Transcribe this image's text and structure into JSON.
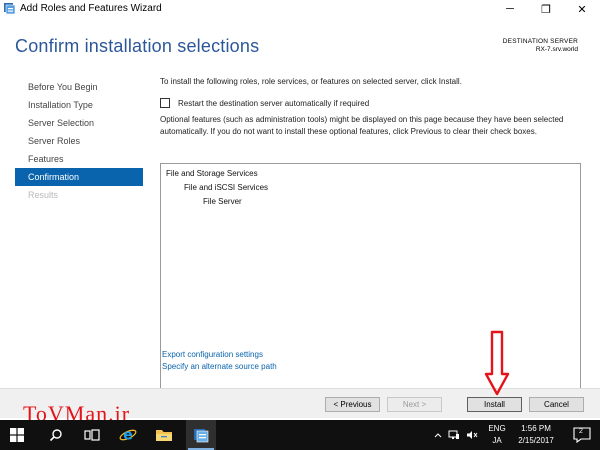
{
  "window": {
    "title": "Add Roles and Features Wizard",
    "minimize_glyph": "─",
    "maximize_glyph": "❐",
    "close_glyph": "✕"
  },
  "header": {
    "title": "Confirm installation selections",
    "destination_label": "DESTINATION SERVER",
    "destination_server": "RX-7.srv.world"
  },
  "sidebar": {
    "items": [
      {
        "label": "Before You Begin",
        "state": "normal"
      },
      {
        "label": "Installation Type",
        "state": "normal"
      },
      {
        "label": "Server Selection",
        "state": "normal"
      },
      {
        "label": "Server Roles",
        "state": "normal"
      },
      {
        "label": "Features",
        "state": "normal"
      },
      {
        "label": "Confirmation",
        "state": "active"
      },
      {
        "label": "Results",
        "state": "disabled"
      }
    ]
  },
  "main": {
    "intro": "To install the following roles, role services, or features on selected server, click Install.",
    "restart_label": "Restart the destination server automatically if required",
    "restart_checked": false,
    "optional_text": "Optional features (such as administration tools) might be displayed on this page because they have been selected automatically. If you do not want to install these optional features, click Previous to clear their check boxes.",
    "features": [
      {
        "label": "File and Storage Services",
        "level": 0
      },
      {
        "label": "File and iSCSI Services",
        "level": 1
      },
      {
        "label": "File Server",
        "level": 2
      }
    ],
    "link_export": "Export configuration settings",
    "link_source": "Specify an alternate source path"
  },
  "footer": {
    "previous_label": "< Previous",
    "next_label": "Next >",
    "install_label": "Install",
    "cancel_label": "Cancel"
  },
  "watermark": "ToVMan.ir",
  "taskbar": {
    "language": "ENG",
    "input_mode": "JA",
    "time": "1:56 PM",
    "date": "2/15/2017",
    "notification_count": "2"
  },
  "colors": {
    "accent": "#0a64ad",
    "title": "#2b579a",
    "annotation": "#e3141b",
    "taskbar": "#101010"
  },
  "icons": {
    "app": "server-manager-icon",
    "start": "windows-start-icon",
    "search": "search-icon",
    "taskview": "task-view-icon",
    "ie": "internet-explorer-icon",
    "explorer": "file-explorer-icon",
    "server": "server-manager-icon",
    "annotation": "red-down-arrow-icon"
  }
}
